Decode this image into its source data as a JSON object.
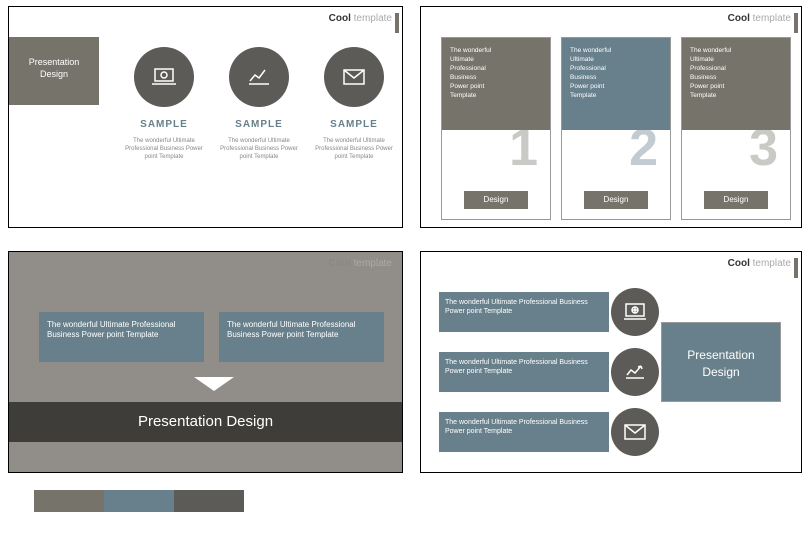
{
  "brand": {
    "bold": "Cool",
    "light": " template"
  },
  "slide1": {
    "title": "Presentation\nDesign",
    "cols": [
      {
        "label": "SAMPLE",
        "desc": "The wonderful Ultimate Professional Business Power point Template"
      },
      {
        "label": "SAMPLE",
        "desc": "The wonderful Ultimate Professional Business Power point Template"
      },
      {
        "label": "SAMPLE",
        "desc": "The wonderful Ultimate Professional Business Power point Template"
      }
    ]
  },
  "slide2": {
    "cards": [
      {
        "text": "The wonderful\nUltimate\nProfessional\nBusiness\nPower point\nTemplate",
        "num": "1",
        "btn": "Design"
      },
      {
        "text": "The wonderful\nUltimate\nProfessional\nBusiness\nPower point\nTemplate",
        "num": "2",
        "btn": "Design"
      },
      {
        "text": "The wonderful\nUltimate\nProfessional\nBusiness\nPower point\nTemplate",
        "num": "3",
        "btn": "Design"
      }
    ]
  },
  "slide3": {
    "box1": "The wonderful Ultimate Professional Business Power point Template",
    "box2": "The wonderful Ultimate Professional Business Power point Template",
    "title": "Presentation Design"
  },
  "slide4": {
    "rows": [
      {
        "text": "The wonderful Ultimate Professional Business Power point Template"
      },
      {
        "text": "The wonderful Ultimate Professional Business Power point Template"
      },
      {
        "text": "The wonderful Ultimate Professional Business Power point Template"
      }
    ],
    "box": "Presentation\nDesign"
  },
  "colors": {
    "c1": "#76736a",
    "c2": "#67808c",
    "c3": "#5c5b58"
  }
}
